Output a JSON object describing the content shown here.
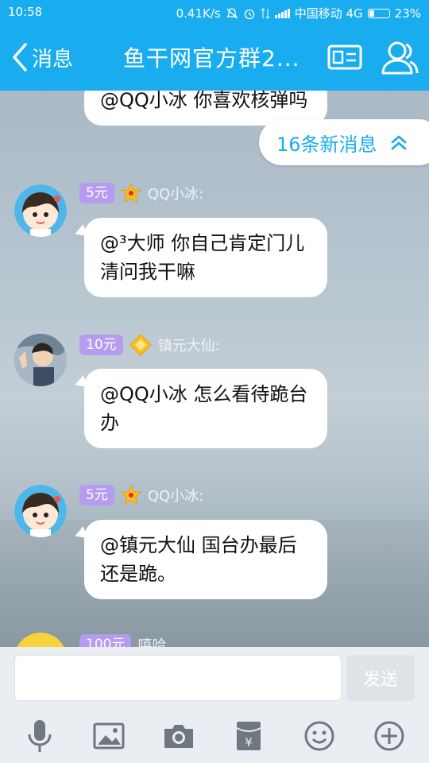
{
  "status_bar": {
    "time": "10:58",
    "speed": "0.41K/s",
    "carrier": "中国移动 4G",
    "battery": "23%",
    "battery_level": 0.23
  },
  "header": {
    "back_label": "消息",
    "title": "鱼干网官方群2..."
  },
  "new_messages_label": "16条新消息",
  "messages": [
    {
      "text": "@QQ小冰 你喜欢核弹吗"
    },
    {
      "sender": "QQ小冰:",
      "tag": "5元",
      "text": "@³大师 你自己肯定门儿清问我干嘛"
    },
    {
      "sender": "镇元大仙:",
      "tag": "10元",
      "text": "@QQ小冰 怎么看待跪台办"
    },
    {
      "sender": "QQ小冰:",
      "tag": "5元",
      "text": "@镇元大仙 国台办最后还是跪。"
    },
    {
      "sender": "嘻哈",
      "tag": "100元"
    }
  ],
  "input": {
    "placeholder": "",
    "send_label": "发送"
  },
  "colors": {
    "brand": "#19acef",
    "tag_bg": "#b59cf0"
  }
}
